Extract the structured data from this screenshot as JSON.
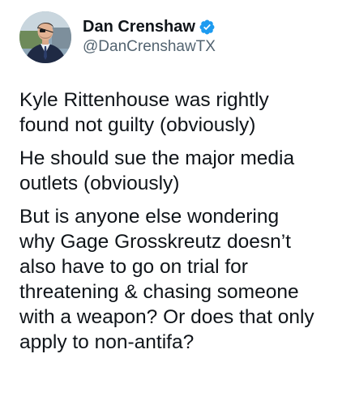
{
  "tweet": {
    "author": {
      "display_name": "Dan Crenshaw",
      "handle": "@DanCrenshawTX",
      "verified": true,
      "avatar_icon": "profile-photo",
      "verified_icon": "verified-badge-icon",
      "verified_color": "#1d9bf0"
    },
    "paragraphs": [
      "Kyle Rittenhouse was rightly\nfound not guilty (obviously)",
      "He should sue the major media\noutlets (obviously)",
      "But is anyone else wondering\nwhy Gage Grosskreutz doesn’t\nalso have to go on trial for\nthreatening & chasing someone\nwith a weapon? Or does that only\napply to non-antifa?"
    ]
  }
}
